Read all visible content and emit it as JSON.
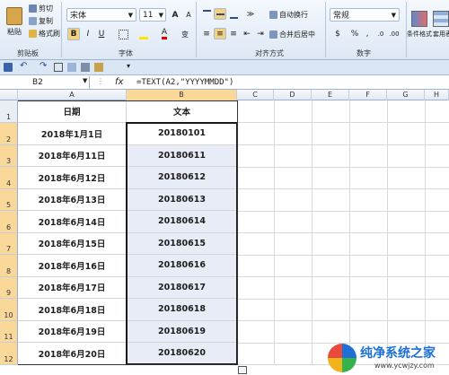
{
  "clipboard": {
    "paste": "粘贴",
    "cut": "剪切",
    "copy": "复制",
    "format_painter": "格式刷",
    "group": "剪贴板"
  },
  "font": {
    "name": "宋体",
    "size": "11",
    "group": "字体"
  },
  "alignment": {
    "wrap": "自动换行",
    "merge": "合并后居中",
    "group": "对齐方式"
  },
  "number": {
    "format": "常规",
    "group": "数字"
  },
  "styles": {
    "cond": "条件格式",
    "table": "套用表格格式"
  },
  "name_box": "B2",
  "formula": "=TEXT(A2,\"YYYYMMDD\")",
  "fx_label": "fx",
  "columns": [
    "A",
    "B",
    "C",
    "D",
    "E",
    "F",
    "G",
    "H"
  ],
  "rows": [
    {
      "num": "1",
      "a": "日期",
      "b": "文本"
    },
    {
      "num": "2",
      "a": "2018年1月1日",
      "b": "20180101"
    },
    {
      "num": "3",
      "a": "2018年6月11日",
      "b": "20180611"
    },
    {
      "num": "4",
      "a": "2018年6月12日",
      "b": "20180612"
    },
    {
      "num": "5",
      "a": "2018年6月13日",
      "b": "20180613"
    },
    {
      "num": "6",
      "a": "2018年6月14日",
      "b": "20180614"
    },
    {
      "num": "7",
      "a": "2018年6月15日",
      "b": "20180615"
    },
    {
      "num": "8",
      "a": "2018年6月16日",
      "b": "20180616"
    },
    {
      "num": "9",
      "a": "2018年6月17日",
      "b": "20180617"
    },
    {
      "num": "10",
      "a": "2018年6月18日",
      "b": "20180618"
    },
    {
      "num": "11",
      "a": "2018年6月19日",
      "b": "20180619"
    },
    {
      "num": "12",
      "a": "2018年6月20日",
      "b": "20180620"
    }
  ],
  "watermark": {
    "brand": "纯净系统之家",
    "url": "www.ycwjzy.com"
  }
}
